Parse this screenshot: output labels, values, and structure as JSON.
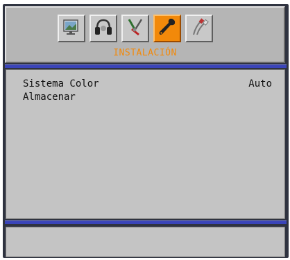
{
  "header": {
    "title": "INSTALACIÓN",
    "icons": [
      {
        "name": "picture-icon",
        "active": false
      },
      {
        "name": "sound-headphones-icon",
        "active": false
      },
      {
        "name": "features-tools-icon",
        "active": false
      },
      {
        "name": "installation-wrench-icon",
        "active": true
      },
      {
        "name": "source-connectors-icon",
        "active": false
      }
    ]
  },
  "menu": {
    "items": [
      {
        "label": "Sistema Color",
        "value": "Auto"
      },
      {
        "label": "Almacenar",
        "value": ""
      }
    ]
  },
  "colors": {
    "accent": "#f2890a",
    "separator": "#3a44b8",
    "panel": "#c4c4c4",
    "frame": "#2f3340"
  }
}
